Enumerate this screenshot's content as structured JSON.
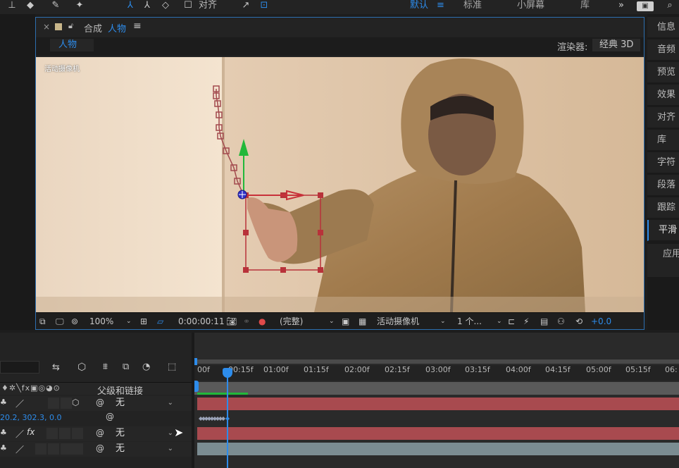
{
  "toolbar": {
    "align_label": "对齐",
    "workspaces": [
      "默认",
      "标准",
      "小屏幕",
      "库"
    ],
    "more": "»"
  },
  "comp_panel": {
    "title_prefix": "合成",
    "comp_name": "人物",
    "tab_label": "人物",
    "renderer_label": "渲染器:",
    "renderer_value": "经典 3D",
    "camera_overlay": "活动摄像机"
  },
  "viewer_footer": {
    "zoom": "100%",
    "timecode": "0:00:00:11",
    "resolution": "(完整)",
    "camera": "活动摄像机",
    "views": "1 个...",
    "exposure": "+0.0"
  },
  "right_panel": {
    "items": [
      "信息",
      "音频",
      "预览",
      "效果",
      "对齐",
      "库",
      "字符",
      "段落",
      "跟踪",
      "平滑"
    ],
    "partial": "应用"
  },
  "timeline": {
    "ruler_labels": [
      "00f",
      "00:15f",
      "01:00f",
      "01:15f",
      "02:00f",
      "02:15f",
      "03:00f",
      "03:15f",
      "04:00f",
      "04:15f",
      "05:00f",
      "05:15f",
      "06:"
    ],
    "parent_header": "父级和链接",
    "layers": [
      {
        "parent": "无"
      },
      {
        "parent": "无"
      },
      {
        "parent": "无"
      }
    ],
    "position_value": "20.2, 302.3, 0.0"
  },
  "colors": {
    "accent": "#2d8ceb",
    "layer_red": "#a84a4f",
    "layer_gray": "#7b8c92",
    "comp_border": "#2d6fb0"
  }
}
